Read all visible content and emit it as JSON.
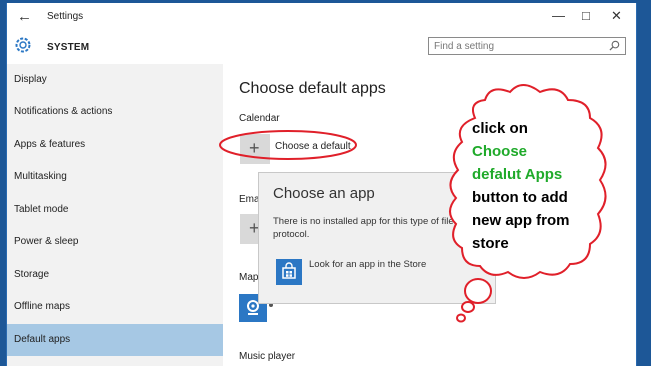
{
  "window": {
    "title": "Settings",
    "back_icon": "back-arrow-icon"
  },
  "controls": {
    "minimize": "—",
    "maximize": "□",
    "close": "✕"
  },
  "header": {
    "section": "SYSTEM",
    "search_placeholder": "Find a setting"
  },
  "sidebar": {
    "items": [
      {
        "label": "Display"
      },
      {
        "label": "Notifications & actions"
      },
      {
        "label": "Apps & features"
      },
      {
        "label": "Multitasking"
      },
      {
        "label": "Tablet mode"
      },
      {
        "label": "Power & sleep"
      },
      {
        "label": "Storage"
      },
      {
        "label": "Offline maps"
      },
      {
        "label": "Default apps"
      }
    ],
    "selected": "Default apps"
  },
  "main": {
    "title": "Choose default apps",
    "calendar_label": "Calendar",
    "choose_default_label": "Choose a default",
    "email_label": "Email",
    "maps_label": "Maps",
    "music_label": "Music player",
    "plus": "+"
  },
  "popup": {
    "title": "Choose an app",
    "message": "There is no installed app for this type of file or protocol.",
    "store_label": "Look for an app in the Store"
  },
  "annotation": {
    "lines": [
      "click on",
      "Choose",
      "defalut Apps",
      "button to add",
      "new app from",
      "store"
    ],
    "colors": {
      "black": "#000000",
      "green": "#1faa2a",
      "red": "#e0202a"
    }
  },
  "colors": {
    "accent": "#1d5797",
    "selected_nav": "#a6c8e4",
    "store_blue": "#2b77c4"
  }
}
